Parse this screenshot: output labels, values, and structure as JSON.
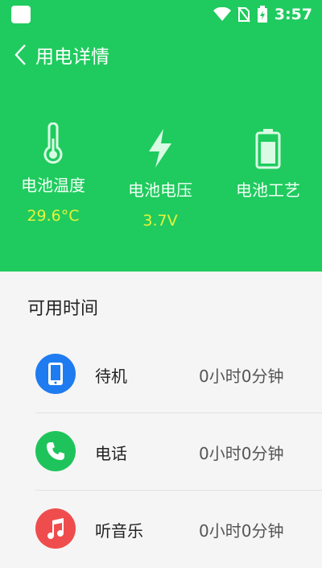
{
  "statusbar": {
    "time": "3:57"
  },
  "header": {
    "title": "用电详情"
  },
  "stats": [
    {
      "label": "电池温度",
      "value": "29.6°C",
      "icon": "thermometer-icon"
    },
    {
      "label": "电池电压",
      "value": "3.7V",
      "icon": "lightning-icon"
    },
    {
      "label": "电池工艺",
      "value": "",
      "icon": "battery-icon"
    }
  ],
  "available": {
    "title": "可用时间",
    "items": [
      {
        "name": "待机",
        "time": "0小时0分钟",
        "icon": "phone-device-icon",
        "color": "#1f7bf0"
      },
      {
        "name": "电话",
        "time": "0小时0分钟",
        "icon": "call-icon",
        "color": "#1ec45b"
      },
      {
        "name": "听音乐",
        "time": "0小时0分钟",
        "icon": "music-icon",
        "color": "#ef4d4d"
      }
    ]
  },
  "colors": {
    "header_bg": "#1fcb5e",
    "value_yellow": "#e8f23a"
  }
}
